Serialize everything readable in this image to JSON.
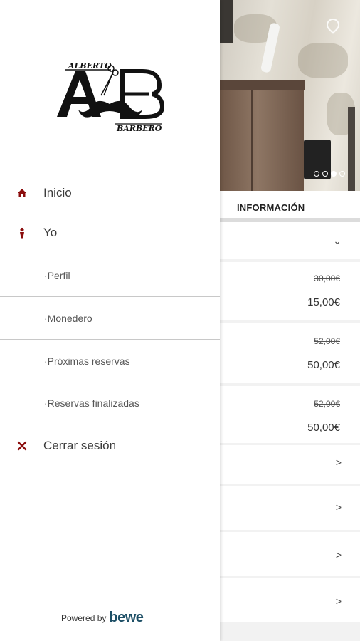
{
  "colors": {
    "accent": "#8b0d0d",
    "divider": "#c8c8c8",
    "text": "#3c3c3c",
    "bewe": "#1d4f66"
  },
  "drawer": {
    "logo": {
      "top_text": "ALBERTO",
      "bottom_text": "BARBERO",
      "initials": "AB"
    },
    "items": [
      {
        "label": "Inicio",
        "icon": "home-icon"
      },
      {
        "label": "Yo",
        "icon": "person-icon"
      },
      {
        "label": "·Perfil"
      },
      {
        "label": "·Monedero"
      },
      {
        "label": "·Próximas reservas"
      },
      {
        "label": "·Reservas finalizadas"
      },
      {
        "label": "Cerrar sesión",
        "icon": "close-icon"
      }
    ],
    "footer": {
      "powered_by": "Powered by",
      "brand": "bewe"
    }
  },
  "background": {
    "carousel": {
      "slides": 4,
      "active_slide": 2
    },
    "section_title": "INFORMACIÓN",
    "expand_chevron": "⌄",
    "services": [
      {
        "old_price": "30,00€",
        "price": "15,00€"
      },
      {
        "old_price": "52,00€",
        "price": "50,00€"
      },
      {
        "old_price": "52,00€",
        "price": "50,00€"
      }
    ],
    "rows": [
      {
        "chevron": ">"
      },
      {
        "chevron": ">"
      },
      {
        "chevron": ">"
      },
      {
        "chevron": ">"
      }
    ]
  }
}
